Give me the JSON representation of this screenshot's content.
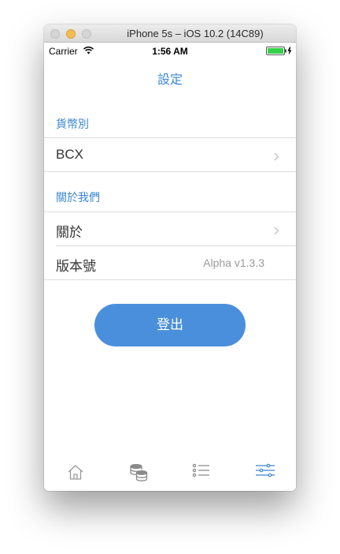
{
  "window": {
    "title": "iPhone 5s – iOS 10.2 (14C89)"
  },
  "status_bar": {
    "carrier": "Carrier",
    "time": "1:56 AM",
    "battery_color": "#35d14a"
  },
  "nav": {
    "title": "設定"
  },
  "sections": [
    {
      "header": "貨幣別",
      "rows": [
        {
          "label": "BCX",
          "value": "",
          "disclosure": true
        }
      ]
    },
    {
      "header": "關於我們",
      "rows": [
        {
          "label": "關於",
          "value": "",
          "disclosure": true
        },
        {
          "label": "版本號",
          "value": "Alpha v1.3.3",
          "disclosure": false
        }
      ]
    }
  ],
  "logout_button": {
    "label": "登出",
    "color": "#4a8fdb"
  },
  "tab_bar": {
    "items": [
      {
        "icon": "home-icon",
        "active": false
      },
      {
        "icon": "coins-icon",
        "active": false
      },
      {
        "icon": "list-icon",
        "active": false
      },
      {
        "icon": "settings-sliders-icon",
        "active": true
      }
    ],
    "active_color": "#3a86cf",
    "inactive_color": "#9a9a9a"
  },
  "accent_color": "#3a86cf"
}
